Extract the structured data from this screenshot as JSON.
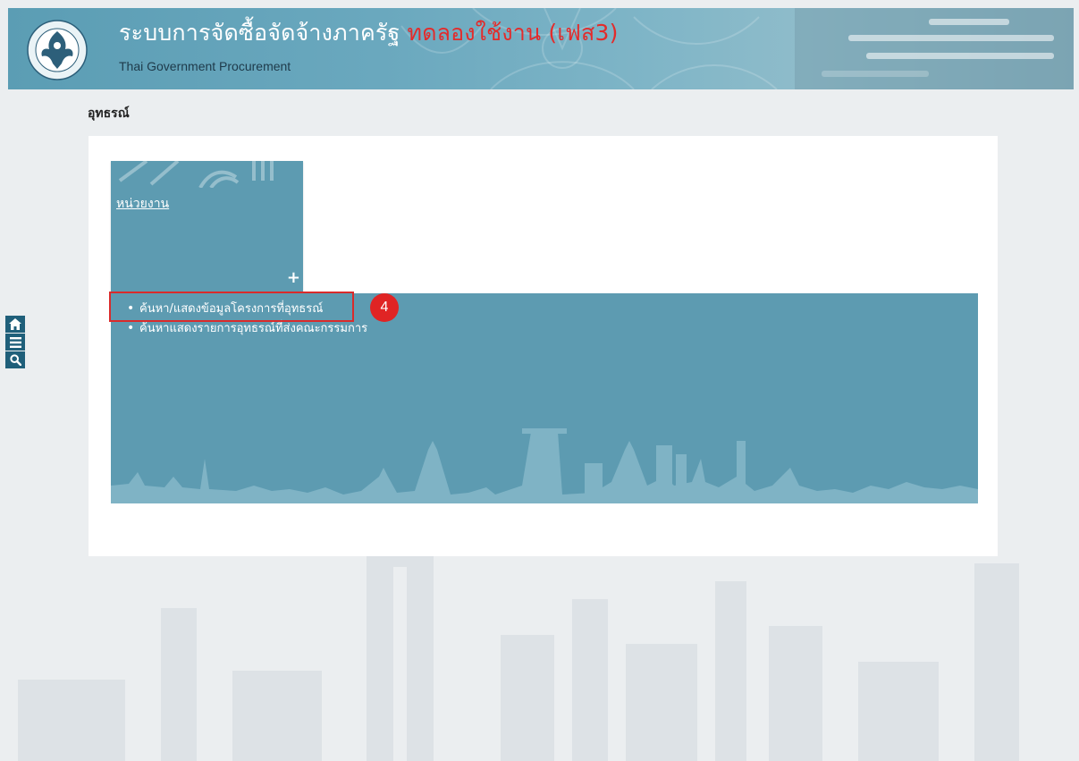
{
  "header": {
    "title": "ระบบการจัดซื้อจัดจ้างภาครัฐ",
    "trial_label": "ทดลองใช้งาน (เฟส3)",
    "subtitle": "Thai Government Procurement"
  },
  "breadcrumb": "อุทธรณ์",
  "tile": {
    "label": "หน่วยงาน",
    "expand_symbol": "+"
  },
  "submenu": {
    "items": [
      "ค้นหา/แสดงข้อมูลโครงการที่อุทธรณ์",
      "ค้นหาแสดงรายการอุทธรณ์ที่ส่งคณะกรรมการ"
    ]
  },
  "step_badge": "4",
  "side_toolbar": {
    "icons": [
      "home-icon",
      "menu-icon",
      "search-icon"
    ]
  },
  "colors": {
    "header": "#5b9db4",
    "tile": "#5d9bb1",
    "trial_label": "#e32b2b",
    "highlight": "#d92b2b",
    "side_toolbar": "#1f5f7a"
  }
}
